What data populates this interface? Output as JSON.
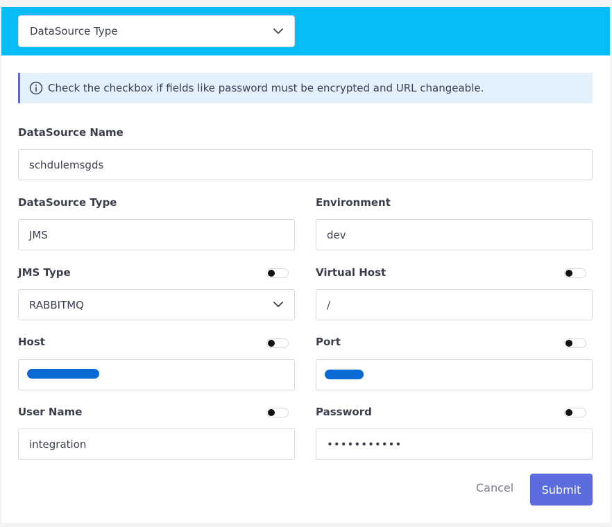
{
  "header": {
    "type_select_value": "DataSource Type"
  },
  "info": {
    "message": "Check the checkbox if fields like password must be encrypted and URL changeable."
  },
  "form": {
    "datasource_name": {
      "label": "DataSource Name",
      "value": "schdulemsgds"
    },
    "datasource_type": {
      "label": "DataSource Type",
      "value": "JMS"
    },
    "environment": {
      "label": "Environment",
      "value": "dev"
    },
    "jms_type": {
      "label": "JMS Type",
      "value": "RABBITMQ",
      "toggle_on": false
    },
    "virtual_host": {
      "label": "Virtual Host",
      "value": "/",
      "toggle_on": false
    },
    "host": {
      "label": "Host",
      "toggle_on": false
    },
    "port": {
      "label": "Port",
      "toggle_on": false
    },
    "user_name": {
      "label": "User Name",
      "value": "integration",
      "toggle_on": false
    },
    "password": {
      "label": "Password",
      "value": "•••••••••••",
      "toggle_on": false
    }
  },
  "actions": {
    "cancel_label": "Cancel",
    "submit_label": "Submit"
  },
  "colors": {
    "header_bg": "#08bcf7",
    "info_bg": "#e2f1fb",
    "submit_bg": "#5a6cde",
    "redaction": "#0a6bd4"
  }
}
